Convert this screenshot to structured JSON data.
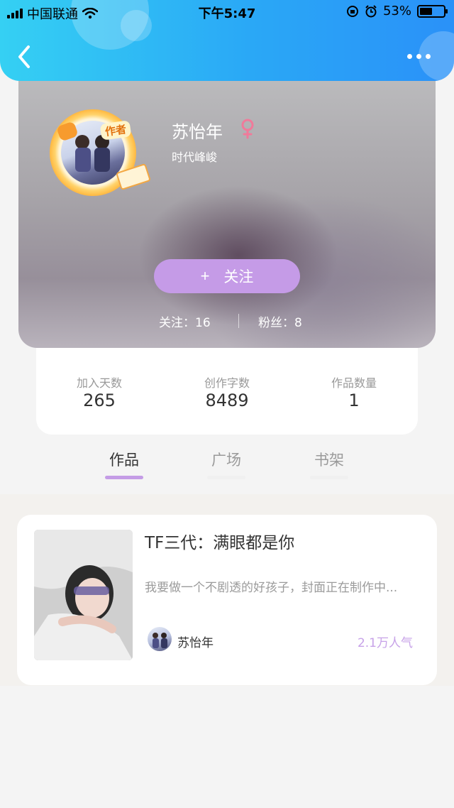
{
  "status_bar": {
    "carrier": "中国联通",
    "time": "下午5:47",
    "battery_percent": "53%",
    "battery_level": 0.53
  },
  "header": {
    "back_icon": "chevron-left-icon",
    "more_icon": "more-dots-icon",
    "accent_gradient": [
      "#35d0f3",
      "#2a91f8"
    ]
  },
  "profile": {
    "name": "苏怡年",
    "author_tag": "作者",
    "subtitle": "时代峰峻",
    "gender_icon": "female-icon",
    "follow_button": {
      "plus": "+",
      "label": "关注"
    },
    "following_text": "关注：16",
    "fans_text": "粉丝：8"
  },
  "info": [
    {
      "label": "加入天数",
      "value": "265"
    },
    {
      "label": "创作字数",
      "value": "8489"
    },
    {
      "label": "作品数量",
      "value": "1"
    }
  ],
  "tabs": [
    {
      "label": "作品",
      "active": true
    },
    {
      "label": "广场",
      "active": false
    },
    {
      "label": "书架",
      "active": false
    }
  ],
  "works": [
    {
      "title": "TF三代：满眼都是你",
      "description": "我要做一个不剧透的好孩子，封面正在制作中...",
      "author": "苏怡年",
      "popularity": "2.1万人气"
    }
  ],
  "colors": {
    "follow_button": "#c59be7",
    "tab_active_underline": "#c49ce6",
    "popularity_text": "#c7a2e8"
  }
}
